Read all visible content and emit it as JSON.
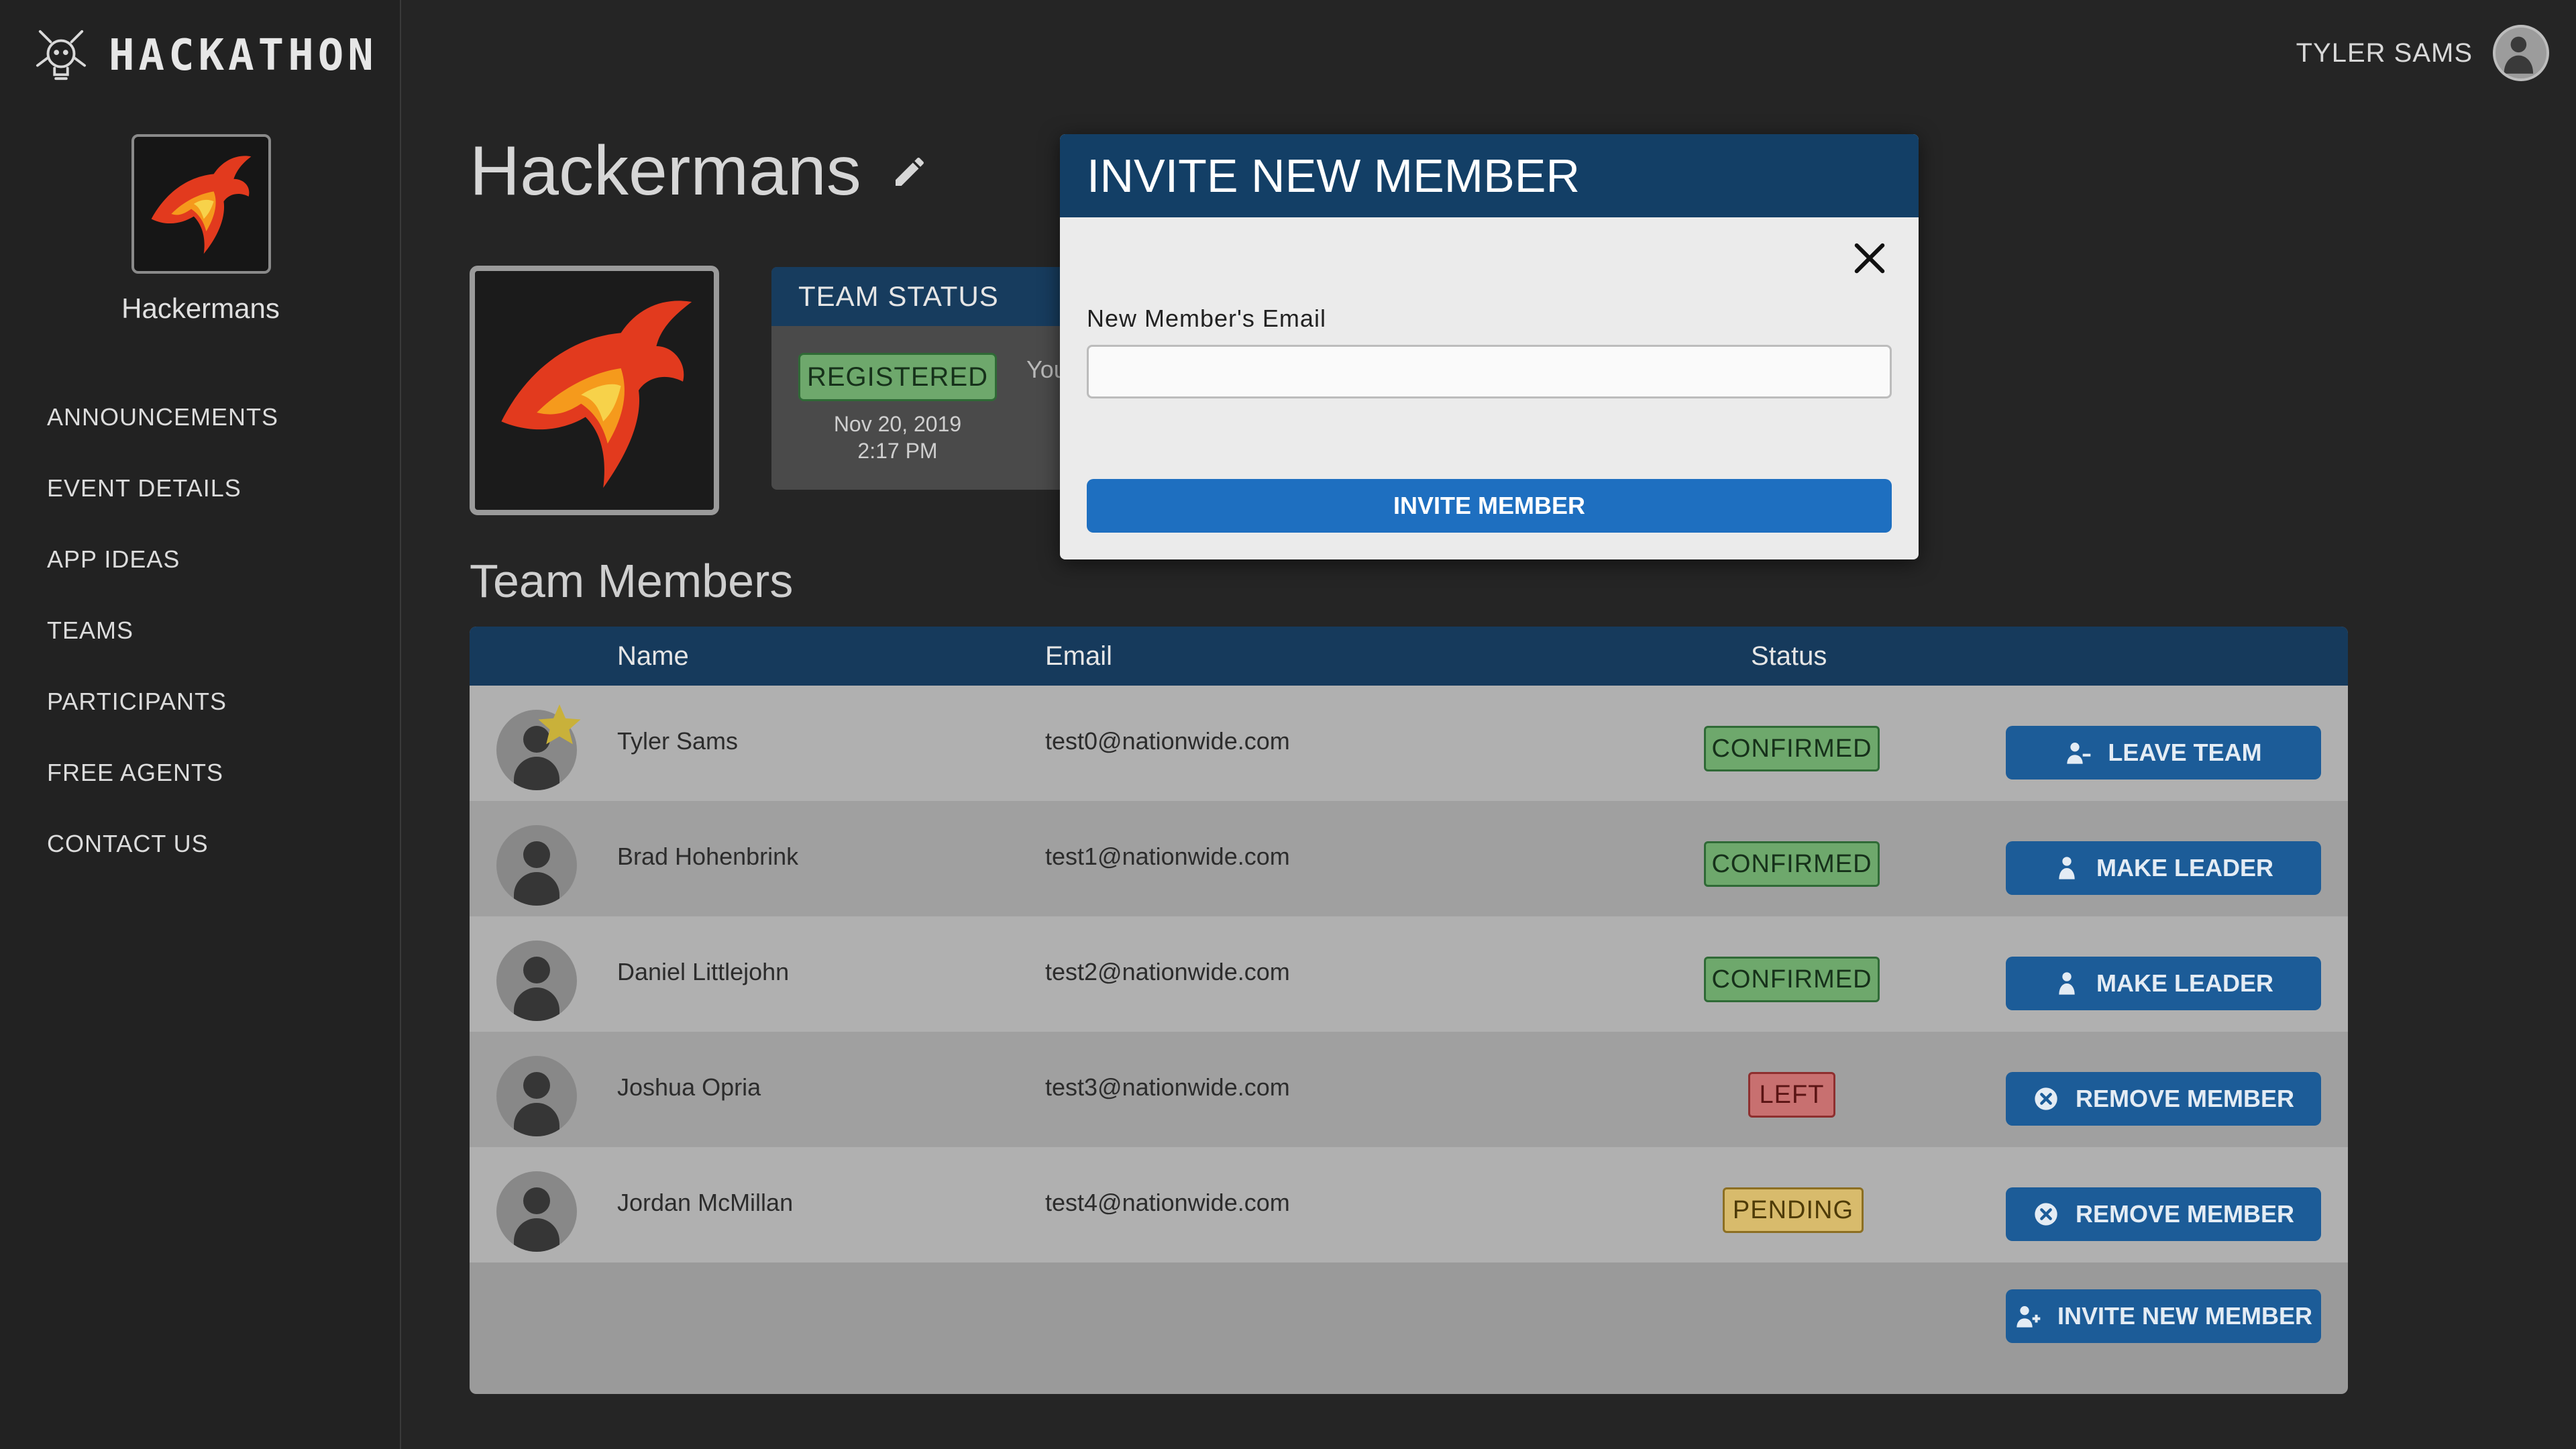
{
  "brand": {
    "name": "HACKATHON"
  },
  "sidebar": {
    "team_name": "Hackermans",
    "nav": [
      "ANNOUNCEMENTS",
      "EVENT DETAILS",
      "APP IDEAS",
      "TEAMS",
      "PARTICIPANTS",
      "FREE AGENTS",
      "CONTACT US"
    ]
  },
  "user": {
    "name": "TYLER SAMS"
  },
  "team": {
    "title": "Hackermans",
    "status": {
      "header": "TEAM STATUS",
      "badge": "REGISTERED",
      "date": "Nov 20, 2019",
      "time": "2:17 PM",
      "note_fragment": "You"
    }
  },
  "members": {
    "title": "Team Members",
    "columns": {
      "name": "Name",
      "email": "Email",
      "status": "Status"
    },
    "rows": [
      {
        "name": "Tyler Sams",
        "email": "test0@nationwide.com",
        "status": "CONFIRMED",
        "action": "LEAVE TEAM"
      },
      {
        "name": "Brad Hohenbrink",
        "email": "test1@nationwide.com",
        "status": "CONFIRMED",
        "action": "MAKE LEADER"
      },
      {
        "name": "Daniel Littlejohn",
        "email": "test2@nationwide.com",
        "status": "CONFIRMED",
        "action": "MAKE LEADER"
      },
      {
        "name": "Joshua Opria",
        "email": "test3@nationwide.com",
        "status": "LEFT",
        "action": "REMOVE MEMBER"
      },
      {
        "name": "Jordan McMillan",
        "email": "test4@nationwide.com",
        "status": "PENDING",
        "action": "REMOVE MEMBER"
      }
    ],
    "invite_button": "INVITE NEW MEMBER"
  },
  "modal": {
    "title": "INVITE NEW MEMBER",
    "email_label": "New Member's Email",
    "email_value": "",
    "submit_label": "INVITE MEMBER"
  },
  "colors": {
    "primary_blue": "#1e6fc0",
    "header_navy": "#133f66",
    "confirmed": "#6ea86c",
    "left": "#c87070",
    "pending": "#d8bb6c"
  },
  "icons": {
    "brand": "robot-lightbulb-icon",
    "edit": "pencil-icon",
    "leader": "star-icon",
    "leave": "user-minus-icon",
    "make_leader": "user-icon",
    "remove": "x-circle-icon",
    "invite": "user-plus-icon",
    "close": "close-icon"
  }
}
